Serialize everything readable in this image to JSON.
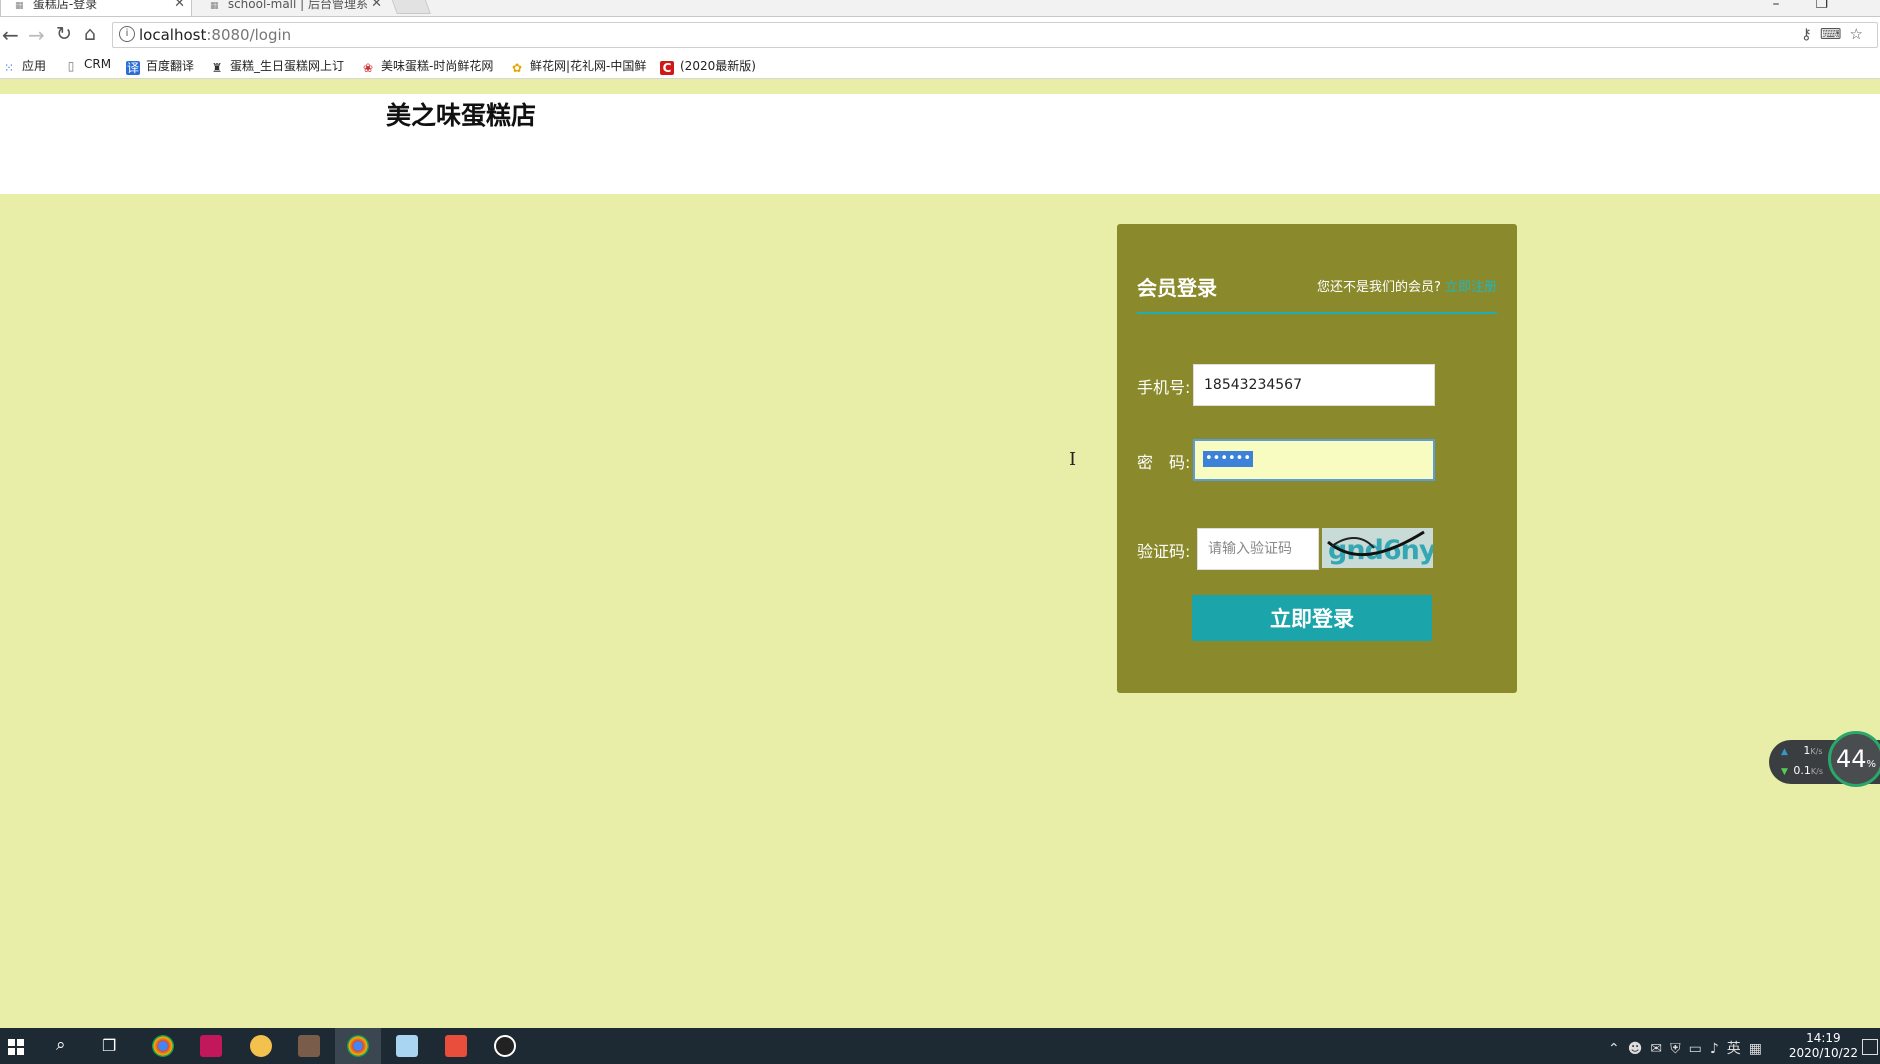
{
  "browser": {
    "tabs": [
      {
        "title": "蛋糕店-登录",
        "active": true
      },
      {
        "title": "school-mall | 后台管理系",
        "active": false
      }
    ],
    "window_controls": [
      "–",
      "❐"
    ],
    "url": {
      "host": "localhost",
      "path": ":8080/login"
    },
    "bookmarks": [
      {
        "label": "应用",
        "icon": "apps-grid-icon"
      },
      {
        "label": "CRM",
        "icon": "page-icon"
      },
      {
        "label": "百度翻译",
        "icon": "translate-icon"
      },
      {
        "label": "蛋糕_生日蛋糕网上订",
        "icon": "cake-site-icon"
      },
      {
        "label": "美味蛋糕-时尚鲜花网",
        "icon": "flower-site-icon"
      },
      {
        "label": "鲜花网|花礼网-中国鲜",
        "icon": "flower-brand-icon"
      },
      {
        "label": "(2020最新版)",
        "icon": "c-brand-icon"
      }
    ]
  },
  "page": {
    "site_title": "美之味蛋糕店"
  },
  "login": {
    "title": "会员登录",
    "register_prompt": "您还不是我们的会员?",
    "register_link": "立即注册",
    "phone_label": "手机号:",
    "phone_value": "18543234567",
    "password_label": "密　码:",
    "password_mask": "••••••",
    "captcha_label": "验证码:",
    "captcha_placeholder": "请输入验证码",
    "captcha_text": "gnd6ny",
    "submit_label": "立即登录"
  },
  "speed_widget": {
    "upload": "1",
    "download": "0.1",
    "unit": "K/s",
    "percent": "44",
    "percent_sign": "%"
  },
  "taskbar": {
    "time": "14:19",
    "date": "2020/10/22",
    "ime": "英"
  },
  "colors": {
    "page_bg": "#e8eda8",
    "panel_bg": "#8a8a2c",
    "accent": "#1ba5aa"
  }
}
